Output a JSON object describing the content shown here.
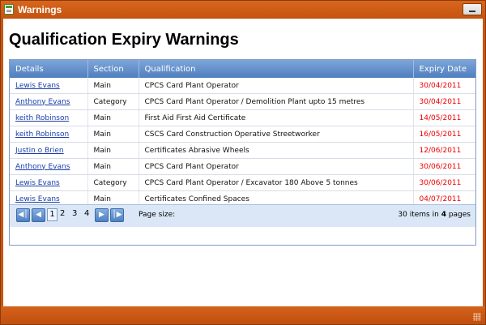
{
  "window": {
    "title": "Warnings"
  },
  "page": {
    "heading": "Qualification Expiry Warnings"
  },
  "grid": {
    "columns": [
      "Details",
      "Section",
      "Qualification",
      "Expiry Date"
    ],
    "rows": [
      {
        "details": "Lewis Evans",
        "section": "Main",
        "qualification": "CPCS Card Plant Operator",
        "expiry": "30/04/2011"
      },
      {
        "details": "Anthony Evans",
        "section": "Category",
        "qualification": "CPCS Card Plant Operator / Demolition Plant upto 15 metres",
        "expiry": "30/04/2011"
      },
      {
        "details": "keith Robinson",
        "section": "Main",
        "qualification": "First Aid First Aid Certificate",
        "expiry": "14/05/2011"
      },
      {
        "details": "keith Robinson",
        "section": "Main",
        "qualification": "CSCS Card Construction Operative Streetworker",
        "expiry": "16/05/2011"
      },
      {
        "details": "Justin o Brien",
        "section": "Main",
        "qualification": "Certificates Abrasive Wheels",
        "expiry": "12/06/2011"
      },
      {
        "details": "Anthony Evans",
        "section": "Main",
        "qualification": "CPCS Card Plant Operator",
        "expiry": "30/06/2011"
      },
      {
        "details": "Lewis Evans",
        "section": "Category",
        "qualification": "CPCS Card Plant Operator / Excavator 180 Above 5 tonnes",
        "expiry": "30/06/2011"
      },
      {
        "details": "Lewis Evans",
        "section": "Main",
        "qualification": "Certificates Confined Spaces",
        "expiry": "04/07/2011"
      }
    ]
  },
  "pager": {
    "first_icon": "first-page-icon",
    "prev_icon": "previous-page-icon",
    "next_icon": "next-page-icon",
    "last_icon": "last-page-icon",
    "pages": [
      "1",
      "2",
      "3",
      "4"
    ],
    "current_page": "1",
    "page_size_label": "Page size:",
    "items_count": "30",
    "items_in": "items in",
    "pages_count": "4",
    "pages_word": "pages"
  },
  "colors": {
    "window_frame": "#c9560f",
    "header": "#5b87c6",
    "link": "#1a3ea8",
    "expiry_text": "#ee0000"
  }
}
